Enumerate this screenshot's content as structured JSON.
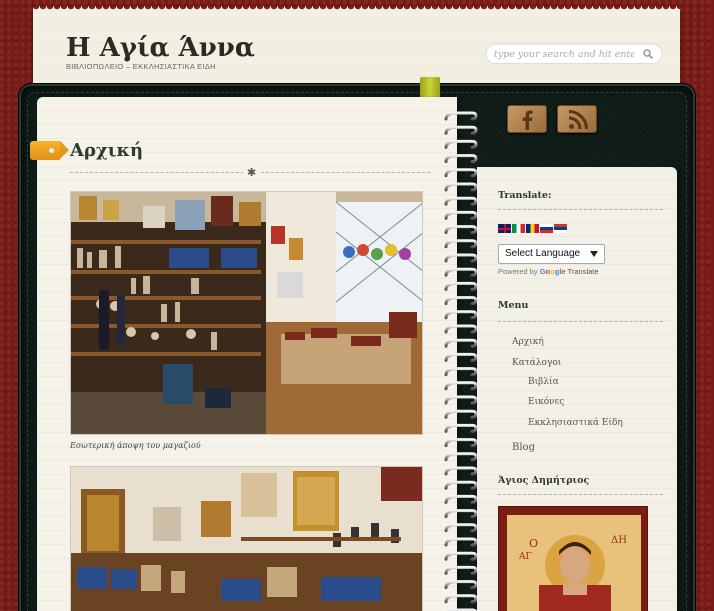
{
  "site": {
    "title": "Η Αγία Άννα",
    "description": "ΒΙΒΛΙΟΠΩΛΕΙΟ – ΕΚΚΛΗΣΙΑΣΤΙΚΑ ΕΙΔΗ"
  },
  "search": {
    "placeholder": "type your search and hit enter"
  },
  "post": {
    "title": "Αρχική",
    "caption": "Εσωτερική άποψη του μαγαζιού"
  },
  "sidebar": {
    "translate": {
      "title": "Translate:",
      "select_value": "Select Language",
      "powered_by": "Powered by",
      "google": "Google",
      "translate_word": "Translate",
      "flags": [
        "english-flag",
        "italian-flag",
        "romanian-flag",
        "russian-flag",
        "serbian-flag"
      ]
    },
    "menu": {
      "title": "Menu",
      "items": [
        {
          "label": "Αρχική"
        },
        {
          "label": "Κατάλογοι"
        },
        {
          "label": "Βιβλία"
        },
        {
          "label": "Εικόνες"
        },
        {
          "label": "Εκκλησιαστικά Είδη"
        },
        {
          "label": "Blog"
        }
      ]
    },
    "saint": {
      "title": "Άγιος Δημήτριος"
    }
  },
  "social": [
    "facebook-icon",
    "rss-icon"
  ],
  "colors": {
    "background": "#7a1a16",
    "binder": "#0f1d17",
    "page": "#f5f2ea",
    "tag": "#f0a522",
    "bookmark": "#b8c22a",
    "title_text": "#2f3a2c"
  }
}
